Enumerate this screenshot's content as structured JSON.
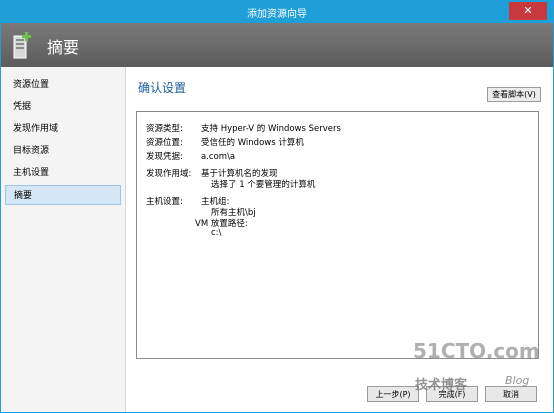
{
  "window": {
    "title": "添加资源向导",
    "close_glyph": "✕"
  },
  "banner": {
    "title": "摘要",
    "icon": "server-add-icon"
  },
  "sidebar": {
    "items": [
      {
        "label": "资源位置"
      },
      {
        "label": "凭据"
      },
      {
        "label": "发现作用域"
      },
      {
        "label": "目标资源"
      },
      {
        "label": "主机设置"
      },
      {
        "label": "摘要",
        "selected": true
      }
    ]
  },
  "main": {
    "heading": "确认设置",
    "view_script_label": "查看脚本(V)",
    "summary": {
      "resource_type": {
        "key": "资源类型:",
        "value": "支持 Hyper-V 的 Windows Servers"
      },
      "resource_location": {
        "key": "资源位置:",
        "value": "受信任的 Windows 计算机"
      },
      "discovery_credentials": {
        "key": "发现凭据:",
        "value": "a.com\\a"
      },
      "discovery_scope": {
        "key": "发现作用域:",
        "value": "基于计算机名的发现",
        "sub": "选择了 1 个要管理的计算机"
      },
      "host_settings": {
        "key": "主机设置:",
        "value": "主机组:",
        "group": "所有主机\\bj",
        "vm_path_label": "VM 放置路径:",
        "vm_path": "c:\\"
      }
    }
  },
  "footer": {
    "prev_label": "上一步(P)",
    "finish_label": "完成(F)",
    "cancel_label": "取消"
  },
  "watermark": {
    "site": "51CTO.com",
    "tagline": "技术博客",
    "blog": "Blog"
  },
  "colors": {
    "titlebar": "#1e9fd8",
    "heading": "#1c5e9e",
    "selected": "#d5e6f7"
  }
}
